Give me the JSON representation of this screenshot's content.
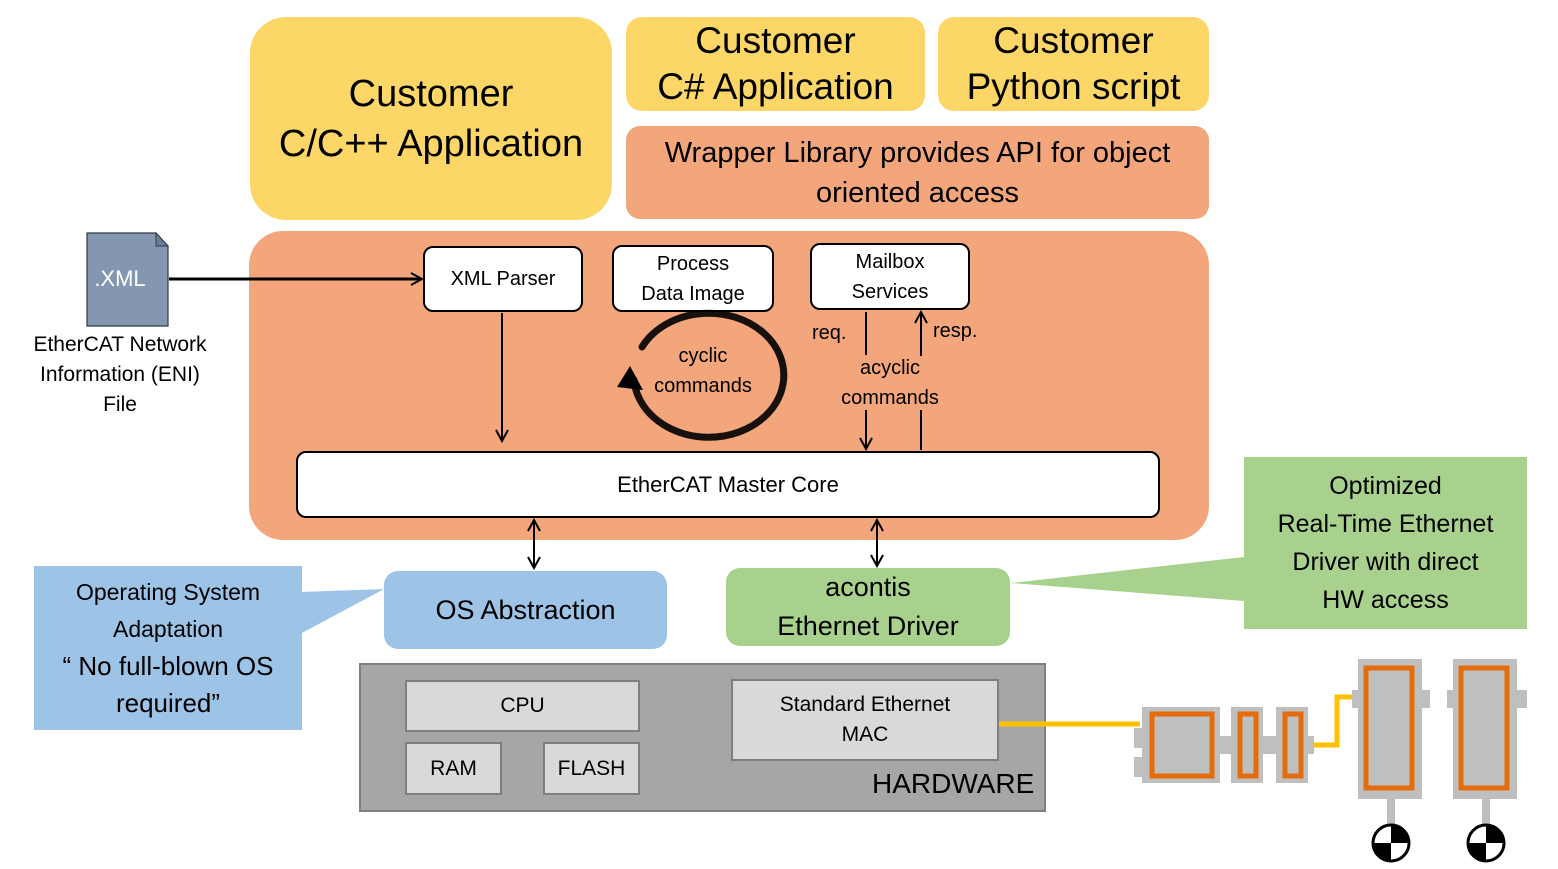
{
  "apps": {
    "cpp": [
      "Customer",
      "C/C++ Application"
    ],
    "csharp": [
      "Customer",
      "C# Application"
    ],
    "python": [
      "Customer",
      "Python script"
    ]
  },
  "wrapper": [
    "Wrapper Library provides API for object",
    "oriented access"
  ],
  "eni_file": {
    "icon_label": ".XML",
    "caption": [
      "EtherCAT Network",
      "Information (ENI)",
      "File"
    ]
  },
  "master_stack": {
    "xml_parser": "XML Parser",
    "process_data_image": [
      "Process",
      "Data Image"
    ],
    "mailbox_services": [
      "Mailbox",
      "Services"
    ],
    "cyclic": [
      "cyclic",
      "commands"
    ],
    "acyclic": [
      "acyclic",
      "commands"
    ],
    "req": "req.",
    "resp": "resp.",
    "master_core": "EtherCAT Master Core"
  },
  "os_abstraction": "OS Abstraction",
  "os_callout": [
    "Operating System",
    "Adaptation",
    "“ No full-blown OS",
    "required”"
  ],
  "ethernet_driver": [
    "acontis",
    "Ethernet Driver"
  ],
  "driver_callout": [
    "Optimized",
    "Real-Time Ethernet",
    "Driver with direct",
    "HW access"
  ],
  "hardware": {
    "label": "HARDWARE",
    "cpu": "CPU",
    "ram": "RAM",
    "flash": "FLASH",
    "mac": [
      "Standard Ethernet",
      "MAC"
    ]
  },
  "colors": {
    "app": "#fcd768",
    "stack": "#f3a67c",
    "os": "#9dc3e6",
    "driver": "#a8d18d",
    "hardware": "#a6a6a6",
    "cable": "#ffc000",
    "slave_frame": "#e46c0a",
    "file_icon": "#8497b0"
  }
}
